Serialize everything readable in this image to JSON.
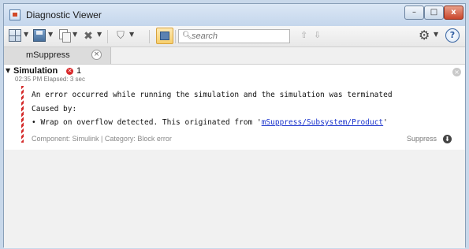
{
  "window": {
    "title": "Diagnostic Viewer",
    "controls": {
      "minimize": "–",
      "maximize": "□",
      "close": "x"
    }
  },
  "toolbar": {
    "search_placeholder": "search",
    "search_value": "",
    "icons": [
      "grid-icon",
      "save-icon",
      "copy-icon",
      "clear-icon",
      "filter-icon",
      "group-icon",
      "search-icon",
      "up-arrow-icon",
      "down-arrow-icon",
      "gear-icon",
      "help-icon"
    ],
    "help_glyph": "?"
  },
  "tabs": [
    {
      "label": "mSuppress",
      "active": true
    }
  ],
  "stage": {
    "title": "Simulation",
    "error_count": "1",
    "meta": "02:35 PM  Elapsed: 3 sec"
  },
  "diagnostic": {
    "message": "An error occurred while running the simulation and the simulation was terminated",
    "caused_by": "Caused by:",
    "cause_prefix": "Wrap on overflow detected. This originated from '",
    "cause_link": "mSuppress/Subsystem/Product",
    "cause_suffix": "'",
    "footer": "Component: Simulink | Category: Block error",
    "suppress_label": "Suppress"
  },
  "colors": {
    "error": "#d9292a",
    "link": "#1a33cc",
    "active_toolbar": "#f7cf6c"
  }
}
